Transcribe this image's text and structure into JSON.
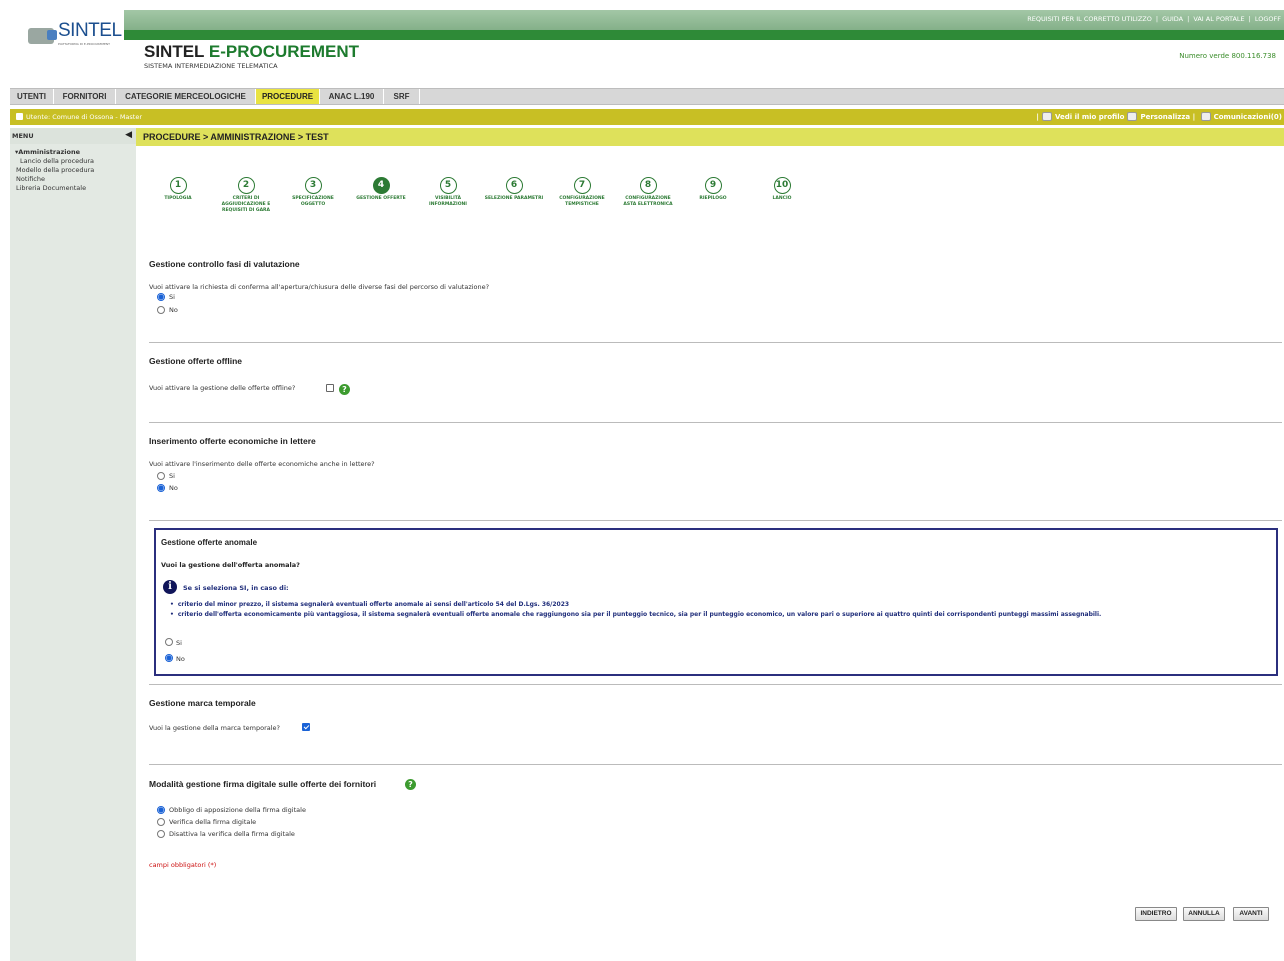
{
  "header": {
    "logo_text": "SINTEL",
    "logo_sub": "PIATTAFORMA DI E-PROCUREMENT",
    "title_part1": "SINTEL ",
    "title_part2": "E-PROCUREMENT",
    "subtitle": "SISTEMA INTERMEDIAZIONE TELEMATICA",
    "phone": "Numero verde 800.116.738",
    "top_links": [
      "REQUISITI PER IL CORRETTO UTILIZZO",
      "GUIDA",
      "VAI AL PORTALE",
      "LOGOFF"
    ]
  },
  "nav": {
    "tabs": [
      {
        "label": "UTENTI",
        "active": false
      },
      {
        "label": "FORNITORI",
        "active": false
      },
      {
        "label": "CATEGORIE MERCEOLOGICHE",
        "active": false
      },
      {
        "label": "PROCEDURE",
        "active": true
      },
      {
        "label": "ANAC L.190",
        "active": false
      },
      {
        "label": "SRF",
        "active": false
      }
    ]
  },
  "userbar": {
    "user": "Utente: Comune di Ossona - Master",
    "profile": "Vedi il mio profilo",
    "customize": "Personalizza",
    "messages": "Comunicazioni(0)"
  },
  "sidebar": {
    "menu_label": "MENU",
    "items": [
      {
        "label": "▾Amministrazione"
      },
      {
        "label": "Lancio della procedura"
      },
      {
        "label": "Modello della procedura"
      },
      {
        "label": "Notifiche"
      },
      {
        "label": "Libreria Documentale"
      }
    ]
  },
  "breadcrumb": "PROCEDURE  > AMMINISTRAZIONE  > TEST",
  "steps": [
    {
      "num": "1",
      "label": "TIPOLOGIA",
      "active": false
    },
    {
      "num": "2",
      "label": "CRITERI DI AGGIUDICAZIONE E REQUISITI DI GARA",
      "active": false
    },
    {
      "num": "3",
      "label": "SPECIFICAZIONE OGGETTO",
      "active": false
    },
    {
      "num": "4",
      "label": "GESTIONE OFFERTE",
      "active": true
    },
    {
      "num": "5",
      "label": "VISIBILITÀ INFORMAZIONI",
      "active": false
    },
    {
      "num": "6",
      "label": "SELEZIONE PARAMETRI",
      "active": false
    },
    {
      "num": "7",
      "label": "CONFIGURAZIONE TEMPISTICHE",
      "active": false
    },
    {
      "num": "8",
      "label": "CONFIGURAZIONE ASTA ELETTRONICA",
      "active": false
    },
    {
      "num": "9",
      "label": "RIEPILOGO",
      "active": false
    },
    {
      "num": "10",
      "label": "LANCIO",
      "active": false
    }
  ],
  "sections": {
    "valutazione": {
      "title": "Gestione controllo fasi di valutazione",
      "question": "Vuoi attivare la richiesta di conferma all'apertura/chiusura delle diverse fasi del percorso di valutazione?",
      "options": [
        {
          "label": "Si",
          "checked": true
        },
        {
          "label": "No",
          "checked": false
        }
      ]
    },
    "offline": {
      "title": "Gestione offerte offline",
      "question": "Vuoi attivare la gestione delle offerte offline?",
      "checked": false
    },
    "lettere": {
      "title": "Inserimento offerte economiche in lettere",
      "question": "Vuoi attivare l'inserimento delle offerte economiche anche in lettere?",
      "options": [
        {
          "label": "Si",
          "checked": false
        },
        {
          "label": "No",
          "checked": true
        }
      ]
    },
    "anomale": {
      "title": "Gestione offerte anomale",
      "question": "Vuoi la gestione dell'offerta anomala?",
      "info_head": "Se si seleziona SI, in caso di:",
      "info_items": [
        "criterio del minor prezzo, il sistema segnalerà eventuali offerte anomale ai sensi dell'articolo 54 del D.Lgs. 36/2023",
        "criterio dell'offerta economicamente più vantaggiosa, il sistema segnalerà eventuali offerte anomale che raggiungono sia per il punteggio tecnico, sia per il punteggio economico, un valore pari o superiore ai quattro quinti dei corrispondenti punteggi massimi assegnabili."
      ],
      "options": [
        {
          "label": "Si",
          "checked": false
        },
        {
          "label": "No",
          "checked": true
        }
      ]
    },
    "marca": {
      "title": "Gestione marca temporale",
      "question": "Vuoi la gestione della marca temporale?",
      "checked": true
    },
    "firma": {
      "title": "Modalità gestione firma digitale sulle offerte dei fornitori",
      "options": [
        {
          "label": "Obbligo di apposizione della firma digitale",
          "checked": true
        },
        {
          "label": "Verifica della firma digitale",
          "checked": false
        },
        {
          "label": "Disattiva la verifica della firma digitale",
          "checked": false
        }
      ]
    }
  },
  "required_note": "campi obbligatori (*)",
  "buttons": {
    "back": "INDIETRO",
    "cancel": "ANNULLA",
    "next": "AVANTI"
  },
  "icons": {
    "help": "help-icon",
    "info": "info-icon"
  },
  "colors": {
    "green": "#2e8a37",
    "yellow": "#c8bf24",
    "box_border": "#2b2f7e",
    "required": "#cc1010"
  }
}
